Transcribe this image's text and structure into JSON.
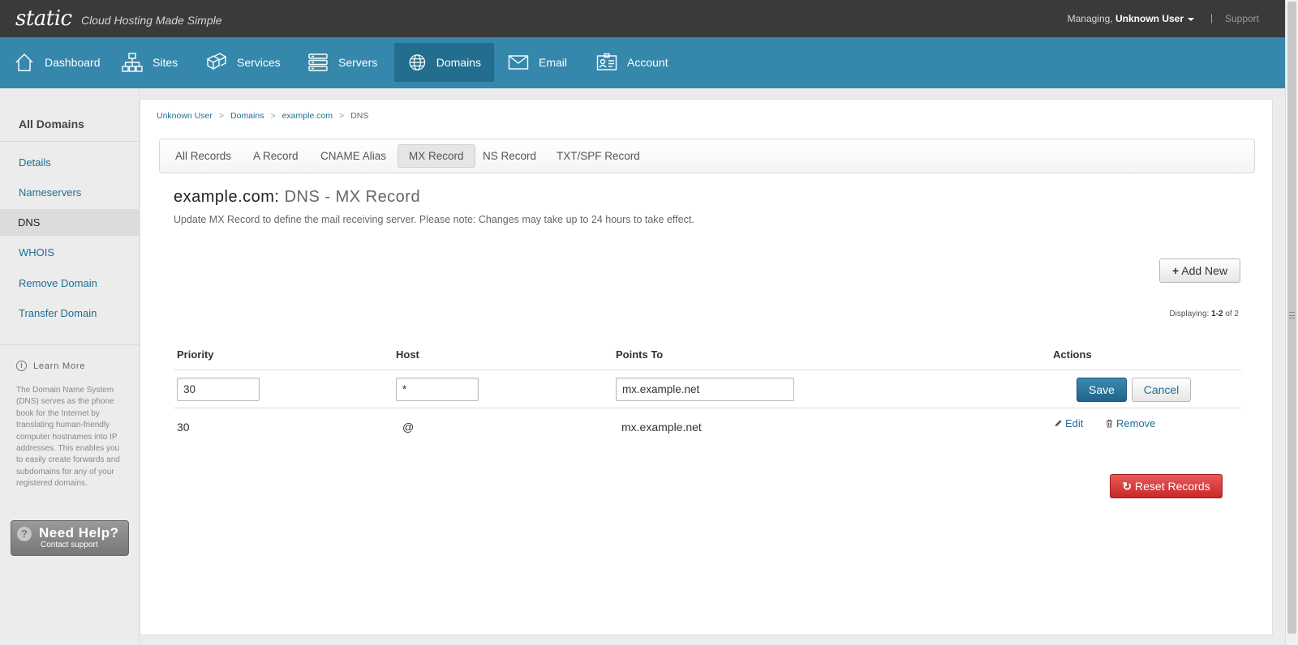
{
  "app": {
    "logo": "static",
    "tagline": "Cloud Hosting Made Simple",
    "managing_label": "Managing,",
    "user": "Unknown User",
    "separator": "|",
    "support": "Support"
  },
  "nav": {
    "items": [
      {
        "label": "Dashboard",
        "icon": "home-icon"
      },
      {
        "label": "Sites",
        "icon": "sitemap-icon"
      },
      {
        "label": "Services",
        "icon": "boxes-icon"
      },
      {
        "label": "Servers",
        "icon": "server-icon"
      },
      {
        "label": "Domains",
        "icon": "globe-icon",
        "active": true
      },
      {
        "label": "Email",
        "icon": "envelope-icon"
      },
      {
        "label": "Account",
        "icon": "id-card-icon"
      }
    ]
  },
  "sidebar": {
    "title": "All Domains",
    "items": [
      {
        "label": "Details"
      },
      {
        "label": "Nameservers"
      },
      {
        "label": "DNS",
        "active": true
      },
      {
        "label": "WHOIS"
      },
      {
        "label": "Remove Domain"
      },
      {
        "label": "Transfer Domain"
      }
    ],
    "learn_more": {
      "title": "Learn More",
      "text": "The Domain Name System (DNS) serves as the phone book for the Internet by translating human-friendly computer hostnames into IP addresses. This enables you to easily create forwards and subdomains for any of your registered domains."
    },
    "help": {
      "title": "Need Help?",
      "subtitle": "Contact support"
    }
  },
  "breadcrumb": {
    "items": [
      "Unknown User",
      "Domains",
      "example.com"
    ],
    "current": "DNS",
    "separator": ">"
  },
  "tabs": [
    {
      "label": "All Records"
    },
    {
      "label": "A Record"
    },
    {
      "label": "CNAME Alias"
    },
    {
      "label": "MX Record",
      "active": true
    },
    {
      "label": "NS Record"
    },
    {
      "label": "TXT/SPF Record"
    }
  ],
  "page": {
    "title_domain": "example.com:",
    "title_sub": "DNS - MX Record",
    "description": "Update MX Record to define the mail receiving server. Please note: Changes may take up to 24 hours to take effect.",
    "add_new_label": "Add New",
    "displaying_prefix": "Displaying:",
    "displaying_range": "1-2",
    "displaying_suffix": "of 2",
    "reset_label": "Reset Records"
  },
  "table": {
    "headers": [
      "Priority",
      "Host",
      "Points To",
      "Actions"
    ],
    "edit_row": {
      "priority": "30",
      "host": "*",
      "points_to": "mx.example.net",
      "save_label": "Save",
      "cancel_label": "Cancel"
    },
    "rows": [
      {
        "priority": "30",
        "host": "@",
        "points_to": "mx.example.net",
        "edit_label": "Edit",
        "remove_label": "Remove"
      }
    ]
  },
  "colors": {
    "topbar": "#3a3a3a",
    "navbar": "#3587ab",
    "nav_active": "#236d8f",
    "link": "#1e6e93",
    "save": "#21648a",
    "reset": "#c82828"
  }
}
